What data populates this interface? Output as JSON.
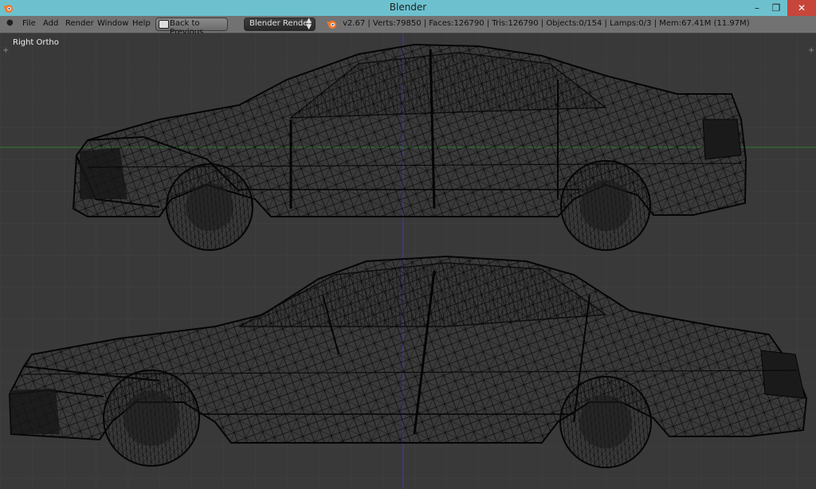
{
  "window": {
    "title": "Blender",
    "icons": {
      "app": "blender-logo-icon",
      "minimize": "minimize-icon",
      "restore": "restore-icon",
      "close": "close-icon"
    }
  },
  "menubar": {
    "items": [
      "File",
      "Add",
      "Render",
      "Window",
      "Help"
    ],
    "back_button": "Back to Previous",
    "render_engine": "Blender Render",
    "stats": "v2.67 | Verts:79850 | Faces:126790 | Tris:126790 | Objects:0/154 | Lamps:0/3 | Mem:67.41M (11.97M)"
  },
  "viewport": {
    "label": "Right Ortho",
    "background": "#393939",
    "grid_color": "#414141",
    "x_axis_color": "#2f7a2f",
    "z_axis_color": "#3a3ab8",
    "wire_color": "#050505"
  }
}
